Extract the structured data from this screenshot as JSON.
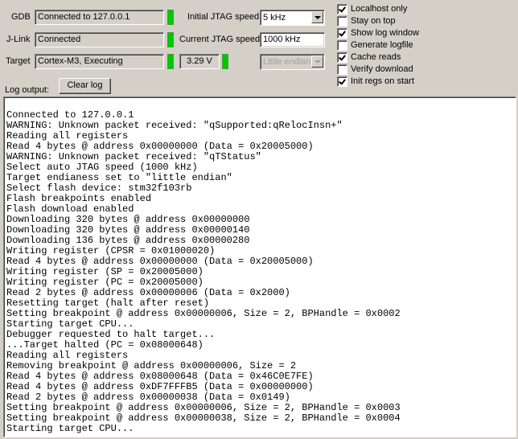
{
  "status": {
    "gdb_label": "GDB",
    "gdb_value": "Connected to 127.0.0.1",
    "jlink_label": "J-Link",
    "jlink_value": "Connected",
    "target_label": "Target",
    "target_value": "Cortex-M3, Executing",
    "voltage_value": "3.29 V",
    "led_color": "#00c800"
  },
  "jtag": {
    "initial_label": "Initial JTAG speed",
    "initial_value": "5 kHz",
    "current_label": "Current JTAG speed",
    "current_value": "1000 kHz",
    "endian_value": "Little endian"
  },
  "options": [
    {
      "label": "Localhost only",
      "checked": true
    },
    {
      "label": "Stay on top",
      "checked": false
    },
    {
      "label": "Show log window",
      "checked": true
    },
    {
      "label": "Generate logfile",
      "checked": false
    },
    {
      "label": "Cache reads",
      "checked": true
    },
    {
      "label": "Verify download",
      "checked": false
    },
    {
      "label": "Init regs on start",
      "checked": true
    }
  ],
  "log": {
    "label": "Log output:",
    "clear_label": "Clear log",
    "lines": [
      "Connected to 127.0.0.1",
      "WARNING: Unknown packet received: \"qSupported:qRelocInsn+\"",
      "Reading all registers",
      "Read 4 bytes @ address 0x00000000 (Data = 0x20005000)",
      "WARNING: Unknown packet received: \"qTStatus\"",
      "Select auto JTAG speed (1000 kHz)",
      "Target endianess set to \"little endian\"",
      "Select flash device: stm32f103rb",
      "Flash breakpoints enabled",
      "Flash download enabled",
      "Downloading 320 bytes @ address 0x00000000",
      "Downloading 320 bytes @ address 0x00000140",
      "Downloading 136 bytes @ address 0x00000280",
      "Writing register (CPSR = 0x01000020)",
      "Read 4 bytes @ address 0x00000000 (Data = 0x20005000)",
      "Writing register (SP = 0x20005000)",
      "Writing register (PC = 0x20005000)",
      "Read 2 bytes @ address 0x00000006 (Data = 0x2000)",
      "Resetting target (halt after reset)",
      "Setting breakpoint @ address 0x00000006, Size = 2, BPHandle = 0x0002",
      "Starting target CPU...",
      "Debugger requested to halt target...",
      "...Target halted (PC = 0x08000648)",
      "Reading all registers",
      "Removing breakpoint @ address 0x00000006, Size = 2",
      "Read 4 bytes @ address 0x08000648 (Data = 0x46C0E7FE)",
      "Read 4 bytes @ address 0xDF7FFFB5 (Data = 0x00000000)",
      "Read 2 bytes @ address 0x00000038 (Data = 0x0149)",
      "Setting breakpoint @ address 0x00000006, Size = 2, BPHandle = 0x0003",
      "Setting breakpoint @ address 0x00000038, Size = 2, BPHandle = 0x0004",
      "Starting target CPU..."
    ]
  }
}
